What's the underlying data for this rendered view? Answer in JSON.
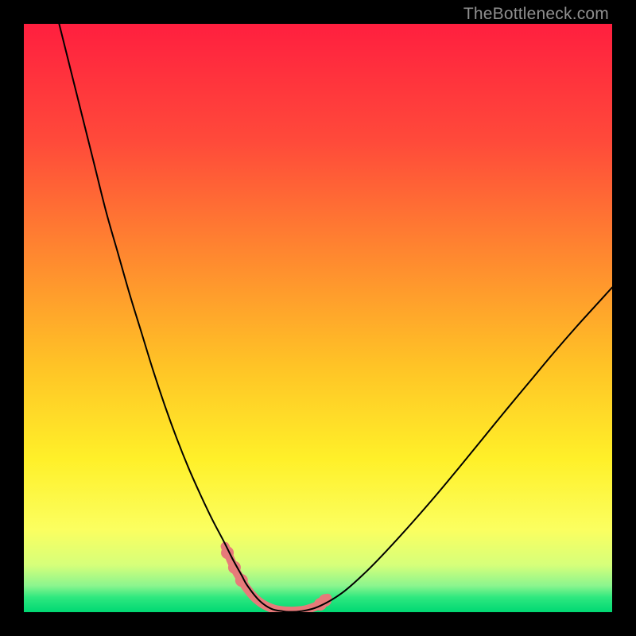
{
  "watermark": "TheBottleneck.com",
  "chart_data": {
    "type": "line",
    "title": "",
    "xlabel": "",
    "ylabel": "",
    "xlim": [
      0,
      100
    ],
    "ylim": [
      0,
      100
    ],
    "grid": false,
    "legend": false,
    "gradient_stops": [
      {
        "offset": 0.0,
        "color": "#ff1f3f"
      },
      {
        "offset": 0.2,
        "color": "#ff4a3a"
      },
      {
        "offset": 0.4,
        "color": "#ff8a2f"
      },
      {
        "offset": 0.58,
        "color": "#ffc326"
      },
      {
        "offset": 0.74,
        "color": "#fff029"
      },
      {
        "offset": 0.86,
        "color": "#fbff60"
      },
      {
        "offset": 0.92,
        "color": "#d6ff7a"
      },
      {
        "offset": 0.955,
        "color": "#8bf58e"
      },
      {
        "offset": 0.975,
        "color": "#2ee87f"
      },
      {
        "offset": 1.0,
        "color": "#00d873"
      }
    ],
    "series": [
      {
        "name": "main-curve",
        "stroke": "#000000",
        "stroke_width": 2.0,
        "x": [
          6,
          8,
          10,
          12,
          14,
          16,
          18,
          20,
          22,
          24,
          26,
          28,
          30,
          32,
          34,
          35.5,
          37,
          38,
          40,
          42,
          44,
          45,
          47,
          50,
          54,
          58,
          62,
          66,
          70,
          74,
          78,
          82,
          86,
          90,
          94,
          98,
          100
        ],
        "y": [
          100,
          92,
          84,
          76,
          68,
          61,
          54,
          47.5,
          41,
          35,
          29.5,
          24.5,
          20,
          15.8,
          12,
          9,
          6.3,
          4.5,
          2.0,
          0.6,
          0.15,
          0.05,
          0.15,
          0.9,
          3.2,
          6.7,
          10.8,
          15.2,
          19.8,
          24.6,
          29.5,
          34.4,
          39.2,
          44.0,
          48.6,
          53.0,
          55.2
        ]
      },
      {
        "name": "highlight-band",
        "stroke": "#e77a7a",
        "stroke_width": 11,
        "x": [
          34.2,
          35.2,
          36.0,
          37.0,
          38.0,
          39.0,
          40.0,
          41.0,
          42.0,
          43.0,
          44.0,
          45.0,
          46.0,
          47.0,
          48.0,
          49.0,
          50.0,
          50.8,
          51.6
        ],
        "y": [
          11.2,
          8.8,
          7.1,
          5.4,
          3.9,
          2.7,
          1.8,
          1.15,
          0.7,
          0.4,
          0.25,
          0.2,
          0.2,
          0.27,
          0.45,
          0.75,
          1.15,
          1.7,
          2.4
        ]
      }
    ],
    "dots": {
      "stroke": "#e77a7a",
      "radius": 8,
      "points": [
        {
          "x": 34.6,
          "y": 10.1
        },
        {
          "x": 35.8,
          "y": 7.6
        },
        {
          "x": 37.0,
          "y": 5.4
        },
        {
          "x": 50.4,
          "y": 1.35
        },
        {
          "x": 51.2,
          "y": 2.0
        }
      ]
    }
  }
}
